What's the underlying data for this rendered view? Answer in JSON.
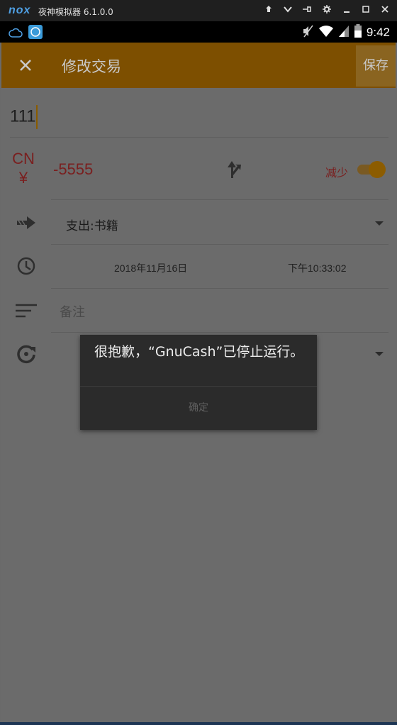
{
  "emulator": {
    "logo": "nox",
    "title": "夜神模拟器 6.1.0.0",
    "controls": [
      "pin-icon",
      "collapse-icon",
      "pin-window-icon",
      "settings-icon",
      "minimize-icon",
      "maximize-icon",
      "close-icon"
    ]
  },
  "status_bar": {
    "time": "9:42"
  },
  "toolbar": {
    "title": "修改交易",
    "save_label": "保存"
  },
  "form": {
    "description": "111",
    "currency_code": "CN",
    "currency_symbol": "¥",
    "amount": "-5555",
    "type_label": "减少",
    "account": "支出:书籍",
    "date": "2018年11月16日",
    "time": "下午10:33:02",
    "notes_placeholder": "备注"
  },
  "dialog": {
    "message": "很抱歉，“GnuCash”已停止运行。",
    "ok_label": "确定"
  },
  "colors": {
    "toolbar": "#7d4f00",
    "accent": "#8c5c00",
    "amount": "#7a1f1f",
    "dialog": "#2b2b2b"
  }
}
